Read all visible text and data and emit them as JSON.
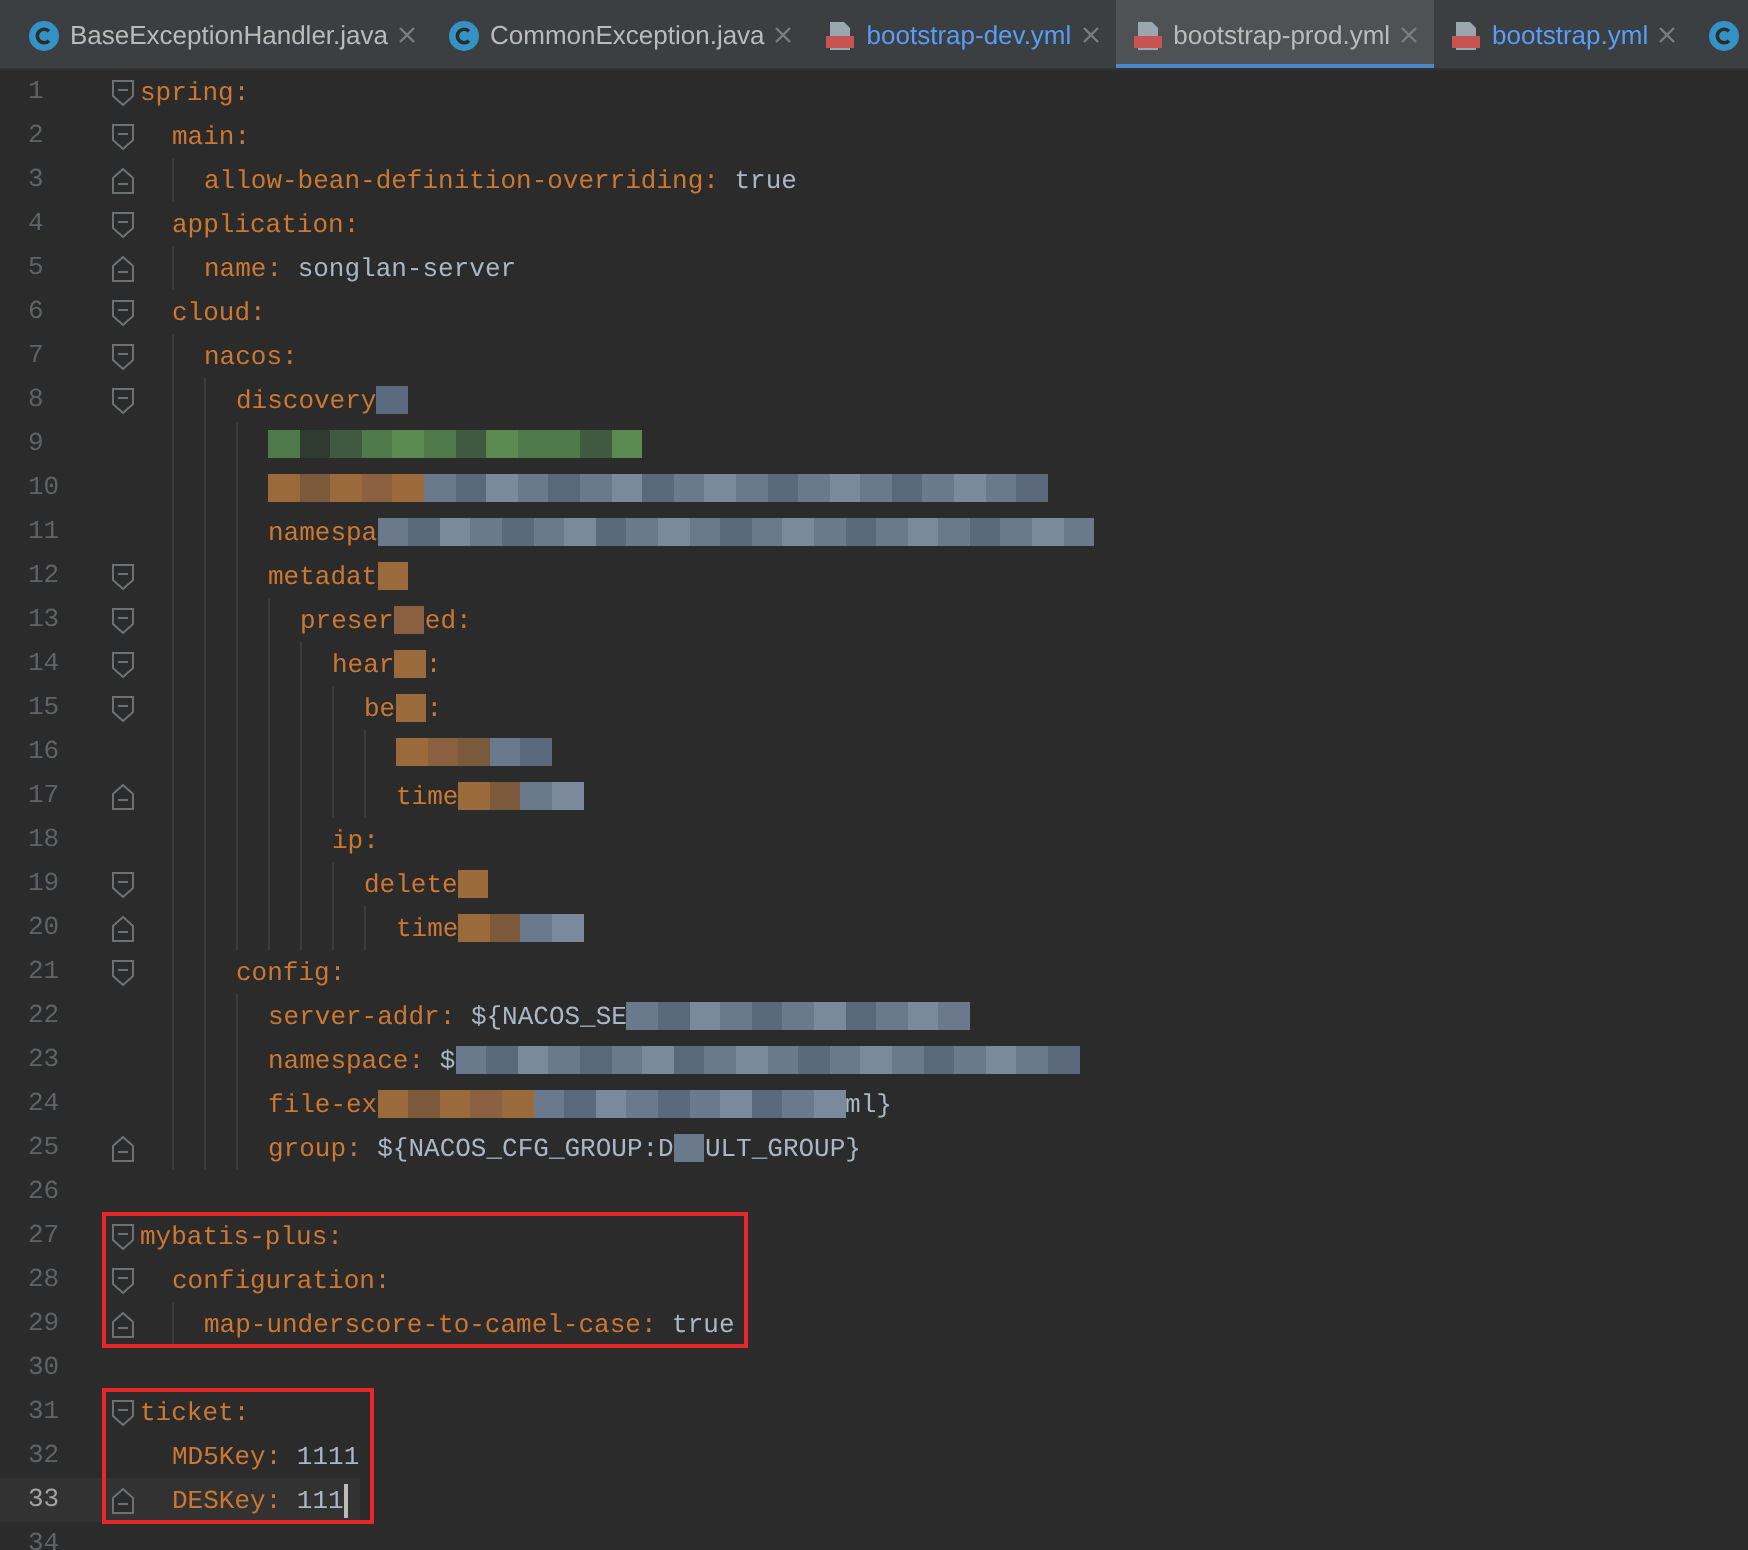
{
  "tabs": [
    {
      "label": "BaseExceptionHandler.java",
      "kind": "java",
      "modified": false,
      "selected": false
    },
    {
      "label": "CommonException.java",
      "kind": "java",
      "modified": false,
      "selected": false
    },
    {
      "label": "bootstrap-dev.yml",
      "kind": "yml",
      "modified": true,
      "selected": false
    },
    {
      "label": "bootstrap-prod.yml",
      "kind": "yml",
      "modified": false,
      "selected": true
    },
    {
      "label": "bootstrap.yml",
      "kind": "yml",
      "modified": true,
      "selected": false
    },
    {
      "kind": "java",
      "selected": false
    }
  ],
  "sections": [
    {
      "boxed": false,
      "lines": [
        {
          "number": "1",
          "kind": "opener",
          "segments": [
            {
              "kind": "key",
              "text": "spring"
            },
            {
              "kind": "punct",
              "text": ":"
            }
          ],
          "children": [
            {
              "number": "2",
              "kind": "opener",
              "segments": [
                {
                  "kind": "key",
                  "text": "main"
                },
                {
                  "kind": "punct",
                  "text": ":"
                }
              ],
              "children": [
                {
                  "number": "3",
                  "kind": "closer",
                  "segments": [
                    {
                      "kind": "key",
                      "text": "allow-bean-definition-overriding"
                    },
                    {
                      "kind": "punct",
                      "text": ":"
                    },
                    {
                      "kind": "value",
                      "text": "true"
                    }
                  ]
                }
              ]
            },
            {
              "number": "4",
              "kind": "opener",
              "segments": [
                {
                  "kind": "key",
                  "text": "application"
                },
                {
                  "kind": "punct",
                  "text": ":"
                }
              ],
              "children": [
                {
                  "number": "5",
                  "kind": "closer",
                  "segments": [
                    {
                      "kind": "key",
                      "text": "name"
                    },
                    {
                      "kind": "punct",
                      "text": ":"
                    },
                    {
                      "kind": "value",
                      "text": "songlan-server"
                    }
                  ]
                }
              ]
            },
            {
              "number": "6",
              "kind": "opener",
              "segments": [
                {
                  "kind": "key",
                  "text": "cloud"
                },
                {
                  "kind": "punct",
                  "text": ":"
                }
              ],
              "children": [
                {
                  "number": "7",
                  "kind": "opener",
                  "segments": [
                    {
                      "kind": "key",
                      "text": "nacos"
                    },
                    {
                      "kind": "punct",
                      "text": ":"
                    }
                  ],
                  "children": [
                    {
                      "number": "8",
                      "kind": "opener",
                      "segments": [
                        {
                          "kind": "key",
                          "text": "discovery"
                        },
                        {
                          "kind": "mask",
                          "cells": [
                            {
                              "color": "#5a6a80"
                            }
                          ]
                        }
                      ],
                      "children": [
                        {
                          "number": "9",
                          "kind": "plain",
                          "segments": [
                            {
                              "kind": "mask",
                              "cells": [
                                {
                                  "color": "#4f7a4a"
                                },
                                {
                                  "color": "#2f3a30"
                                },
                                {
                                  "color": "#3f5a40"
                                },
                                {
                                  "color": "#4f7a4a"
                                },
                                {
                                  "color": "#5a8a50"
                                },
                                {
                                  "color": "#4f7a4a"
                                },
                                {
                                  "color": "#3f5a40"
                                },
                                {
                                  "color": "#5a8a50"
                                },
                                {
                                  "color": "#4f7a4a"
                                },
                                {
                                  "color": "#4f7a4a"
                                },
                                {
                                  "color": "#3f5a40"
                                },
                                {
                                  "color": "#5a8a50"
                                }
                              ]
                            }
                          ]
                        },
                        {
                          "number": "10",
                          "kind": "plain",
                          "segments": [
                            {
                              "kind": "mask",
                              "cells": [
                                {
                                  "color": "#9a6a3a"
                                },
                                {
                                  "color": "#7a5a3a"
                                },
                                {
                                  "color": "#9a6a3a"
                                },
                                {
                                  "color": "#8a6040"
                                },
                                {
                                  "color": "#9a6a3a"
                                }
                              ]
                            },
                            {
                              "kind": "mask",
                              "cells": [
                                {
                                  "color": "#6a7a8c"
                                },
                                {
                                  "color": "#5a6a7c"
                                },
                                {
                                  "color": "#7a8a9c"
                                },
                                {
                                  "color": "#6a7a8c"
                                },
                                {
                                  "color": "#5a6a7c"
                                },
                                {
                                  "color": "#6a7a8c"
                                },
                                {
                                  "color": "#7a8a9c"
                                },
                                {
                                  "color": "#5a6a7c"
                                },
                                {
                                  "color": "#6a7a8c"
                                },
                                {
                                  "color": "#7a8a9c"
                                },
                                {
                                  "color": "#6a7a8c"
                                },
                                {
                                  "color": "#5a6a7c"
                                },
                                {
                                  "color": "#6a7a8c"
                                },
                                {
                                  "color": "#7a8a9c"
                                },
                                {
                                  "color": "#6a7a8c"
                                },
                                {
                                  "color": "#5a6a7c"
                                },
                                {
                                  "color": "#6a7a8c"
                                },
                                {
                                  "color": "#7a8a9c"
                                },
                                {
                                  "color": "#6a7a8c"
                                },
                                {
                                  "color": "#5a6a7c"
                                }
                              ]
                            }
                          ]
                        },
                        {
                          "number": "11",
                          "kind": "plain",
                          "segments": [
                            {
                              "kind": "key",
                              "text": "namespa"
                            },
                            {
                              "kind": "mask",
                              "cells": [
                                {
                                  "color": "#6a7a8c"
                                },
                                {
                                  "color": "#5a6a7c"
                                },
                                {
                                  "color": "#7a8a9c"
                                },
                                {
                                  "color": "#6a7a8c"
                                },
                                {
                                  "color": "#5a6a7c"
                                },
                                {
                                  "color": "#6a7a8c"
                                },
                                {
                                  "color": "#7a8a9c"
                                },
                                {
                                  "color": "#5a6a7c"
                                },
                                {
                                  "color": "#6a7a8c"
                                },
                                {
                                  "color": "#7a8a9c"
                                },
                                {
                                  "color": "#6a7a8c"
                                },
                                {
                                  "color": "#5a6a7c"
                                },
                                {
                                  "color": "#6a7a8c"
                                },
                                {
                                  "color": "#7a8a9c"
                                },
                                {
                                  "color": "#6a7a8c"
                                },
                                {
                                  "color": "#5a6a7c"
                                },
                                {
                                  "color": "#6a7a8c"
                                },
                                {
                                  "color": "#7a8a9c"
                                },
                                {
                                  "color": "#6a7a8c"
                                },
                                {
                                  "color": "#5a6a7c"
                                },
                                {
                                  "color": "#6a7a8c"
                                },
                                {
                                  "color": "#7a8a9c"
                                },
                                {
                                  "color": "#6a7a8c"
                                }
                              ]
                            }
                          ]
                        },
                        {
                          "number": "12",
                          "kind": "opener",
                          "segments": [
                            {
                              "kind": "key",
                              "text": "metadat"
                            },
                            {
                              "kind": "mask",
                              "cells": [
                                {
                                  "color": "#9a6a3a"
                                }
                              ]
                            }
                          ],
                          "children": [
                            {
                              "number": "13",
                              "kind": "opener",
                              "segments": [
                                {
                                  "kind": "key",
                                  "text": "preser"
                                },
                                {
                                  "kind": "mask",
                                  "cells": [
                                    {
                                      "color": "#8a6040"
                                    }
                                  ]
                                },
                                {
                                  "kind": "key",
                                  "text": "ed"
                                },
                                {
                                  "kind": "punct",
                                  "text": ":"
                                }
                              ],
                              "children": [
                                {
                                  "number": "14",
                                  "kind": "opener",
                                  "segments": [
                                    {
                                      "kind": "key",
                                      "text": "hear"
                                    },
                                    {
                                      "kind": "mask",
                                      "cells": [
                                        {
                                          "color": "#9a6a3a"
                                        }
                                      ]
                                    },
                                    {
                                      "kind": "punct",
                                      "text": ":"
                                    }
                                  ],
                                  "children": [
                                    {
                                      "number": "15",
                                      "kind": "opener",
                                      "segments": [
                                        {
                                          "kind": "key",
                                          "text": "be"
                                        },
                                        {
                                          "kind": "mask",
                                          "cells": [
                                            {
                                              "color": "#9a6a3a"
                                            }
                                          ]
                                        },
                                        {
                                          "kind": "punct",
                                          "text": ":"
                                        }
                                      ],
                                      "children": [
                                        {
                                          "number": "16",
                                          "kind": "plain",
                                          "segments": [
                                            {
                                              "kind": "mask",
                                              "cells": [
                                                {
                                                  "color": "#9a6a3a"
                                                },
                                                {
                                                  "color": "#8a6040"
                                                },
                                                {
                                                  "color": "#7a5a3a"
                                                }
                                              ]
                                            },
                                            {
                                              "kind": "mask",
                                              "cells": [
                                                {
                                                  "color": "#6a7a8c"
                                                },
                                                {
                                                  "color": "#5a6a7c"
                                                }
                                              ]
                                            }
                                          ]
                                        },
                                        {
                                          "number": "17",
                                          "kind": "closer",
                                          "segments": [
                                            {
                                              "kind": "key",
                                              "text": "time"
                                            },
                                            {
                                              "kind": "mask",
                                              "cells": [
                                                {
                                                  "color": "#9a6a3a"
                                                },
                                                {
                                                  "color": "#7a5a3a"
                                                }
                                              ]
                                            },
                                            {
                                              "kind": "mask",
                                              "cells": [
                                                {
                                                  "color": "#6a7a8c"
                                                },
                                                {
                                                  "color": "#7a8a9c"
                                                }
                                              ]
                                            }
                                          ]
                                        }
                                      ]
                                    }
                                  ]
                                },
                                {
                                  "number": "18",
                                  "kind": "plain",
                                  "segments": [
                                    {
                                      "kind": "key",
                                      "text": "ip"
                                    },
                                    {
                                      "kind": "punct",
                                      "text": ":"
                                    }
                                  ],
                                  "children": [
                                    {
                                      "number": "19",
                                      "kind": "opener",
                                      "segments": [
                                        {
                                          "kind": "key",
                                          "text": "delete"
                                        },
                                        {
                                          "kind": "mask",
                                          "cells": [
                                            {
                                              "color": "#9a6a3a"
                                            }
                                          ]
                                        }
                                      ],
                                      "children": [
                                        {
                                          "number": "20",
                                          "kind": "closer",
                                          "segments": [
                                            {
                                              "kind": "key",
                                              "text": "time"
                                            },
                                            {
                                              "kind": "mask",
                                              "cells": [
                                                {
                                                  "color": "#9a6a3a"
                                                },
                                                {
                                                  "color": "#7a5a3a"
                                                }
                                              ]
                                            },
                                            {
                                              "kind": "mask",
                                              "cells": [
                                                {
                                                  "color": "#6a7a8c"
                                                },
                                                {
                                                  "color": "#7a8a9c"
                                                }
                                              ]
                                            }
                                          ]
                                        }
                                      ]
                                    }
                                  ]
                                }
                              ]
                            }
                          ]
                        }
                      ]
                    },
                    {
                      "number": "21",
                      "kind": "opener",
                      "segments": [
                        {
                          "kind": "key",
                          "text": "config"
                        },
                        {
                          "kind": "punct",
                          "text": ":"
                        }
                      ],
                      "children": [
                        {
                          "number": "22",
                          "kind": "plain",
                          "segments": [
                            {
                              "kind": "key",
                              "text": "server-addr"
                            },
                            {
                              "kind": "punct",
                              "text": ":"
                            },
                            {
                              "kind": "value",
                              "text": "${NACOS_SE"
                            },
                            {
                              "kind": "mask",
                              "cells": [
                                {
                                  "color": "#6a7a8c"
                                },
                                {
                                  "color": "#5a6a7c"
                                },
                                {
                                  "color": "#7a8a9c"
                                },
                                {
                                  "color": "#6a7a8c"
                                },
                                {
                                  "color": "#5a6a7c"
                                },
                                {
                                  "color": "#6a7a8c"
                                },
                                {
                                  "color": "#7a8a9c"
                                },
                                {
                                  "color": "#5a6a7c"
                                },
                                {
                                  "color": "#6a7a8c"
                                },
                                {
                                  "color": "#7a8a9c"
                                },
                                {
                                  "color": "#6a7a8c"
                                }
                              ]
                            }
                          ]
                        },
                        {
                          "number": "23",
                          "kind": "plain",
                          "segments": [
                            {
                              "kind": "key",
                              "text": "namespace"
                            },
                            {
                              "kind": "punct",
                              "text": ":"
                            },
                            {
                              "kind": "value",
                              "text": "$"
                            },
                            {
                              "kind": "mask",
                              "cells": [
                                {
                                  "color": "#6a7a8c"
                                },
                                {
                                  "color": "#5a6a7c"
                                },
                                {
                                  "color": "#7a8a9c"
                                },
                                {
                                  "color": "#6a7a8c"
                                },
                                {
                                  "color": "#5a6a7c"
                                },
                                {
                                  "color": "#6a7a8c"
                                },
                                {
                                  "color": "#7a8a9c"
                                },
                                {
                                  "color": "#5a6a7c"
                                },
                                {
                                  "color": "#6a7a8c"
                                },
                                {
                                  "color": "#7a8a9c"
                                },
                                {
                                  "color": "#6a7a8c"
                                },
                                {
                                  "color": "#5a6a7c"
                                },
                                {
                                  "color": "#6a7a8c"
                                },
                                {
                                  "color": "#7a8a9c"
                                },
                                {
                                  "color": "#6a7a8c"
                                },
                                {
                                  "color": "#5a6a7c"
                                },
                                {
                                  "color": "#6a7a8c"
                                },
                                {
                                  "color": "#7a8a9c"
                                },
                                {
                                  "color": "#6a7a8c"
                                },
                                {
                                  "color": "#5a6a7c"
                                }
                              ]
                            }
                          ]
                        },
                        {
                          "number": "24",
                          "kind": "plain",
                          "segments": [
                            {
                              "kind": "key",
                              "text": "file-ex"
                            },
                            {
                              "kind": "mask",
                              "cells": [
                                {
                                  "color": "#9a6a3a"
                                },
                                {
                                  "color": "#7a5a3a"
                                },
                                {
                                  "color": "#9a6a3a"
                                },
                                {
                                  "color": "#8a6040"
                                },
                                {
                                  "color": "#9a6a3a"
                                }
                              ]
                            },
                            {
                              "kind": "mask",
                              "cells": [
                                {
                                  "color": "#6a7a8c"
                                },
                                {
                                  "color": "#5a6a7c"
                                },
                                {
                                  "color": "#7a8a9c"
                                },
                                {
                                  "color": "#6a7a8c"
                                },
                                {
                                  "color": "#5a6a7c"
                                },
                                {
                                  "color": "#6a7a8c"
                                },
                                {
                                  "color": "#7a8a9c"
                                },
                                {
                                  "color": "#5a6a7c"
                                },
                                {
                                  "color": "#6a7a8c"
                                },
                                {
                                  "color": "#7a8a9c"
                                }
                              ]
                            },
                            {
                              "kind": "value",
                              "text": "ml}"
                            }
                          ]
                        },
                        {
                          "number": "25",
                          "kind": "closer",
                          "segments": [
                            {
                              "kind": "key",
                              "text": "group"
                            },
                            {
                              "kind": "punct",
                              "text": ":"
                            },
                            {
                              "kind": "value",
                              "text": "${NACOS_CFG_GROUP:D"
                            },
                            {
                              "kind": "mask",
                              "cells": [
                                {
                                  "color": "#6a7a8c"
                                }
                              ]
                            },
                            {
                              "kind": "value",
                              "text": "ULT_GROUP}"
                            }
                          ]
                        }
                      ]
                    }
                  ]
                }
              ]
            }
          ]
        },
        {
          "number": "26",
          "kind": "plain"
        }
      ]
    },
    {
      "boxed": true,
      "lines": [
        {
          "number": "27",
          "kind": "opener",
          "segments": [
            {
              "kind": "key",
              "text": "mybatis-plus"
            },
            {
              "kind": "punct",
              "text": ":"
            }
          ],
          "children": [
            {
              "number": "28",
              "kind": "opener",
              "segments": [
                {
                  "kind": "key",
                  "text": "configuration"
                },
                {
                  "kind": "punct",
                  "text": ":"
                }
              ],
              "children": [
                {
                  "number": "29",
                  "kind": "closer",
                  "segments": [
                    {
                      "kind": "key",
                      "text": "map-underscore-to-camel-case"
                    },
                    {
                      "kind": "punct",
                      "text": ":"
                    },
                    {
                      "kind": "value",
                      "text": "true"
                    }
                  ]
                }
              ]
            }
          ]
        }
      ]
    },
    {
      "boxed": false,
      "lines": [
        {
          "number": "30",
          "kind": "plain"
        }
      ]
    },
    {
      "boxed": true,
      "lines": [
        {
          "number": "31",
          "kind": "opener",
          "segments": [
            {
              "kind": "key",
              "text": "ticket"
            },
            {
              "kind": "punct",
              "text": ":"
            }
          ],
          "children": [
            {
              "number": "32",
              "kind": "plain",
              "segments": [
                {
                  "kind": "key",
                  "text": "MD5Key"
                },
                {
                  "kind": "punct",
                  "text": ":"
                },
                {
                  "kind": "value",
                  "text": "1111"
                }
              ]
            },
            {
              "number": "33",
              "kind": "closer",
              "current": true,
              "segments": [
                {
                  "kind": "key",
                  "text": "DESKey"
                },
                {
                  "kind": "punct",
                  "text": ":"
                },
                {
                  "kind": "value",
                  "text": "111"
                }
              ]
            }
          ]
        }
      ]
    },
    {
      "boxed": false,
      "lines": [
        {
          "number": "34",
          "kind": "plain"
        }
      ]
    }
  ]
}
